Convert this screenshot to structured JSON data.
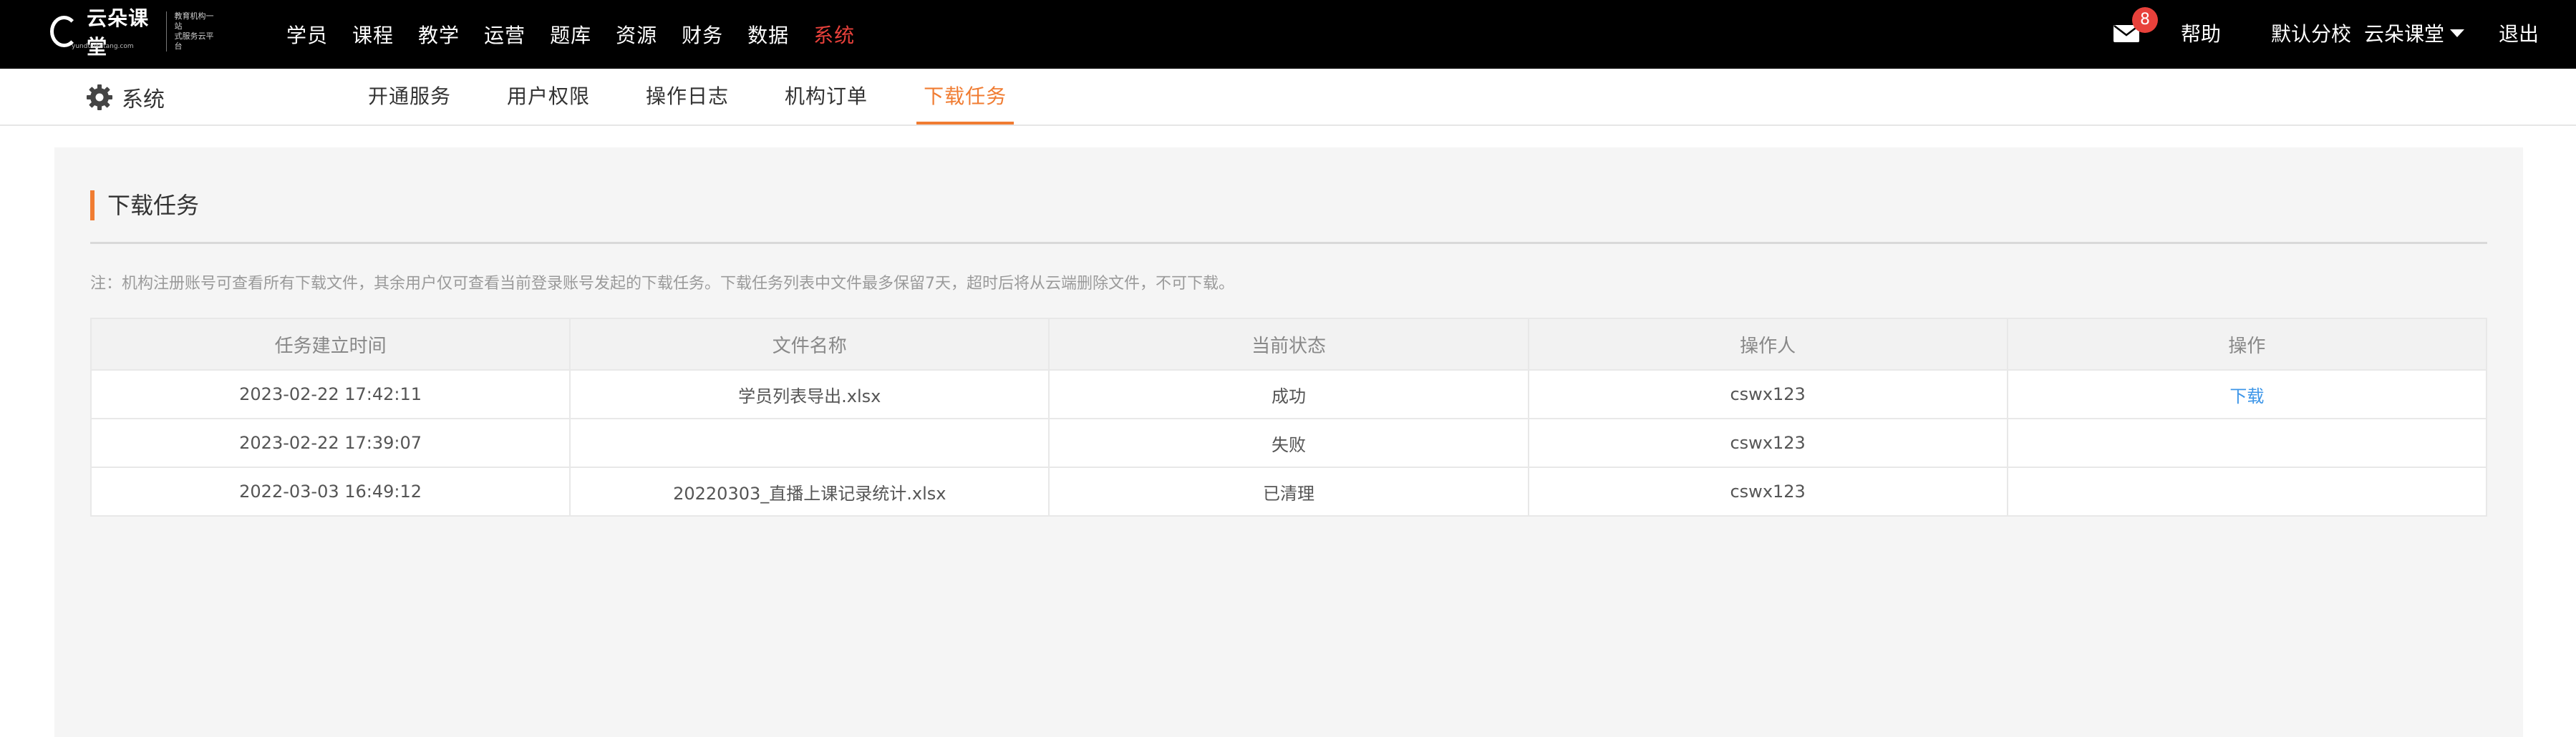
{
  "brand": {
    "name": "云朵课堂",
    "tagline_line1": "教育机构一站",
    "tagline_line2": "式服务云平台",
    "domain": "yunduoketang.com"
  },
  "topnav": {
    "items": [
      "学员",
      "课程",
      "教学",
      "运营",
      "题库",
      "资源",
      "财务",
      "数据",
      "系统"
    ],
    "active": "系统",
    "active_color": "#e8413b"
  },
  "header_right": {
    "mail_badge": "8",
    "help": "帮助",
    "school": "默认分校",
    "org": "云朵课堂",
    "logout": "退出"
  },
  "subnav": {
    "section": "系统",
    "tabs": [
      "开通服务",
      "用户权限",
      "操作日志",
      "机构订单",
      "下载任务"
    ],
    "active": "下载任务",
    "accent_color": "#f07c32"
  },
  "main": {
    "title": "下载任务",
    "note": "注：机构注册账号可查看所有下载文件，其余用户仅可查看当前登录账号发起的下载任务。下载任务列表中文件最多保留7天，超时后将从云端删除文件，不可下载。"
  },
  "table": {
    "headers": [
      "任务建立时间",
      "文件名称",
      "当前状态",
      "操作人",
      "操作"
    ],
    "rows": [
      {
        "time": "2023-02-22 17:42:11",
        "file": "学员列表导出.xlsx",
        "status": "成功",
        "operator": "cswx123",
        "action": "下载"
      },
      {
        "time": "2023-02-22 17:39:07",
        "file": "",
        "status": "失败",
        "operator": "cswx123",
        "action": ""
      },
      {
        "time": "2022-03-03 16:49:12",
        "file": "20220303_直播上课记录统计.xlsx",
        "status": "已清理",
        "operator": "cswx123",
        "action": ""
      }
    ],
    "link_color": "#3d96e8"
  },
  "icons": {
    "mail": "mail-icon",
    "gear": "gear-icon",
    "caret": "caret-down-icon",
    "logo": "cloud-logo-icon"
  }
}
